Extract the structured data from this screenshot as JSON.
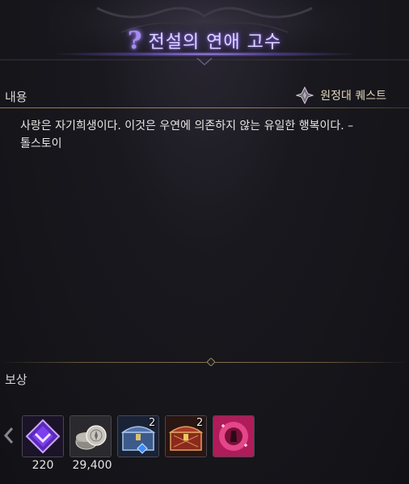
{
  "quest": {
    "title": "전설의 연애 고수",
    "category": "원정대 퀘스트",
    "icon": "question-mark-icon"
  },
  "content": {
    "label": "내용",
    "description": "사랑은 자기희생이다. 이것은 우연에 의존하지 않는 유일한 행복이다. –\n톨스토이"
  },
  "rewards": {
    "label": "보상",
    "items": [
      {
        "icon": "purple-emblem-icon",
        "amount": "220",
        "count": ""
      },
      {
        "icon": "silver-coin-icon",
        "amount": "29,400",
        "count": ""
      },
      {
        "icon": "blue-chest-icon",
        "amount": "",
        "count": "2"
      },
      {
        "icon": "red-chest-icon",
        "amount": "",
        "count": "2"
      },
      {
        "icon": "pink-emote-card-icon",
        "amount": "",
        "count": ""
      }
    ]
  },
  "colors": {
    "accent_purple": "#a58cf0",
    "gold_line": "#b4965a",
    "background": "#19181e"
  }
}
